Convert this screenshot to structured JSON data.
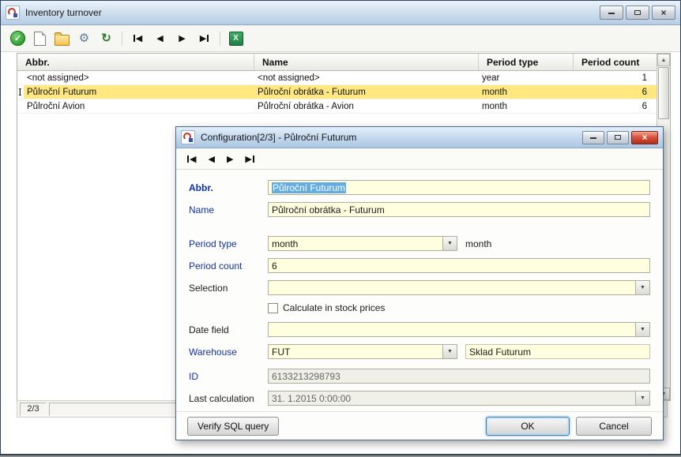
{
  "icons": {
    "check": "✓",
    "gear": "⚙",
    "refresh": "↻",
    "left": "◀",
    "right": "▶",
    "up": "▲",
    "down": "▼",
    "excel": "X",
    "close": "×",
    "text_cursor": "I"
  },
  "main_window": {
    "title": "Inventory turnover",
    "table": {
      "columns": [
        "Abbr.",
        "Name",
        "Period type",
        "Period count"
      ],
      "rows": [
        {
          "abbr": "<not assigned>",
          "name": "<not assigned>",
          "period_type": "year",
          "period_count": "1"
        },
        {
          "abbr": "Půlroční Futurum",
          "name": "Půlroční obrátka - Futurum",
          "period_type": "month",
          "period_count": "6"
        },
        {
          "abbr": "Půlroční Avion",
          "name": "Půlroční obrátka - Avion",
          "period_type": "month",
          "period_count": "6"
        }
      ],
      "selected_row_index": 1
    },
    "status_count": "2/3"
  },
  "dialog": {
    "title": "Configuration[2/3] - Půlroční Futurum",
    "fields": {
      "abbr": {
        "label": "Abbr.",
        "value": "Půlroční Futurum"
      },
      "name": {
        "label": "Name",
        "value": "Půlroční obrátka - Futurum"
      },
      "period_type": {
        "label": "Period type",
        "value": "month",
        "suffix": "month"
      },
      "period_count": {
        "label": "Period count",
        "value": "6"
      },
      "selection": {
        "label": "Selection",
        "value": ""
      },
      "calc_stock_prices": {
        "label": "Calculate in stock prices",
        "checked": false
      },
      "date_field": {
        "label": "Date field",
        "value": ""
      },
      "warehouse": {
        "label": "Warehouse",
        "value": "FUT",
        "suffix": "Sklad Futurum"
      },
      "id": {
        "label": "ID",
        "value": "6133213298793"
      },
      "last_calculation": {
        "label": "Last calculation",
        "value": "31. 1.2015 0:00:00"
      }
    },
    "buttons": {
      "verify": "Verify SQL query",
      "ok": "OK",
      "cancel": "Cancel"
    }
  }
}
